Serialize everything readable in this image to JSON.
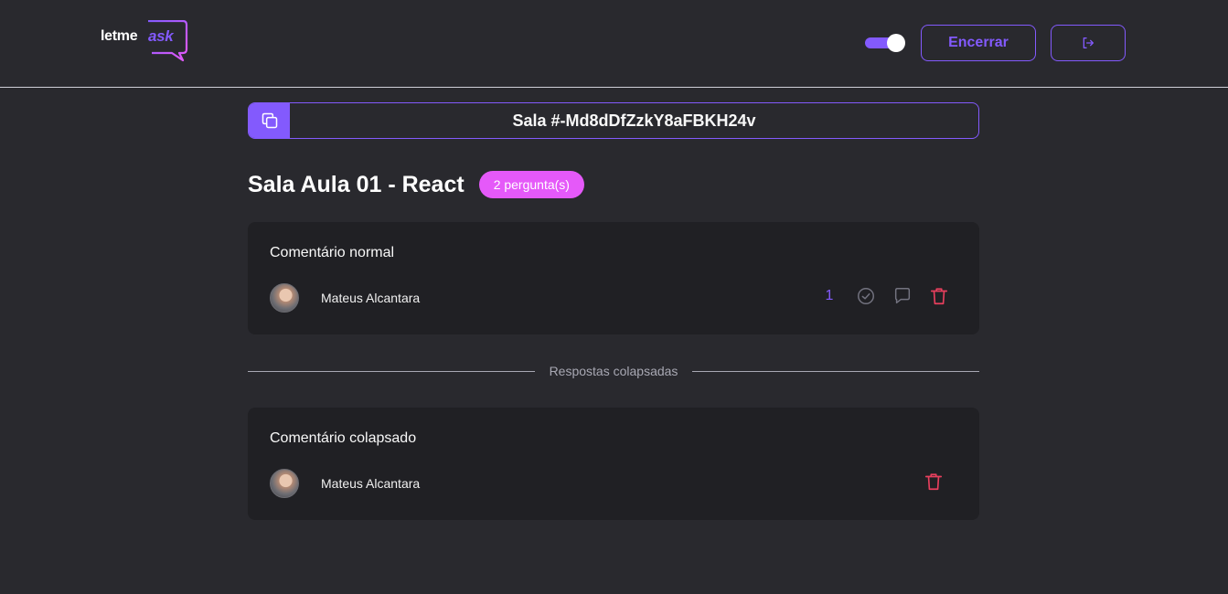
{
  "header": {
    "logo_text_1": "letme",
    "logo_text_2": "ask",
    "close_button": "Encerrar",
    "theme_toggle": {
      "state": "on"
    },
    "logout_icon": "logout-icon"
  },
  "room": {
    "code": "Sala #-Md8dDfZzkY8aFBKH24v",
    "title": "Sala Aula 01 - React",
    "question_count": "2 pergunta(s)"
  },
  "questions": [
    {
      "content": "Comentário normal",
      "author": "Mateus Alcantara",
      "likes": "1",
      "actions": [
        "check-circle-icon",
        "answer-icon",
        "trash-icon"
      ]
    },
    {
      "content": "Comentário colapsado",
      "author": "Mateus Alcantara",
      "actions": [
        "trash-icon"
      ]
    }
  ],
  "divider_label": "Respostas colapsadas",
  "colors": {
    "background": "#29292e",
    "card": "#202024",
    "accent": "#835afd",
    "badge": "#e559f9",
    "danger": "#e73f5d",
    "muted": "#a8a8b3"
  }
}
